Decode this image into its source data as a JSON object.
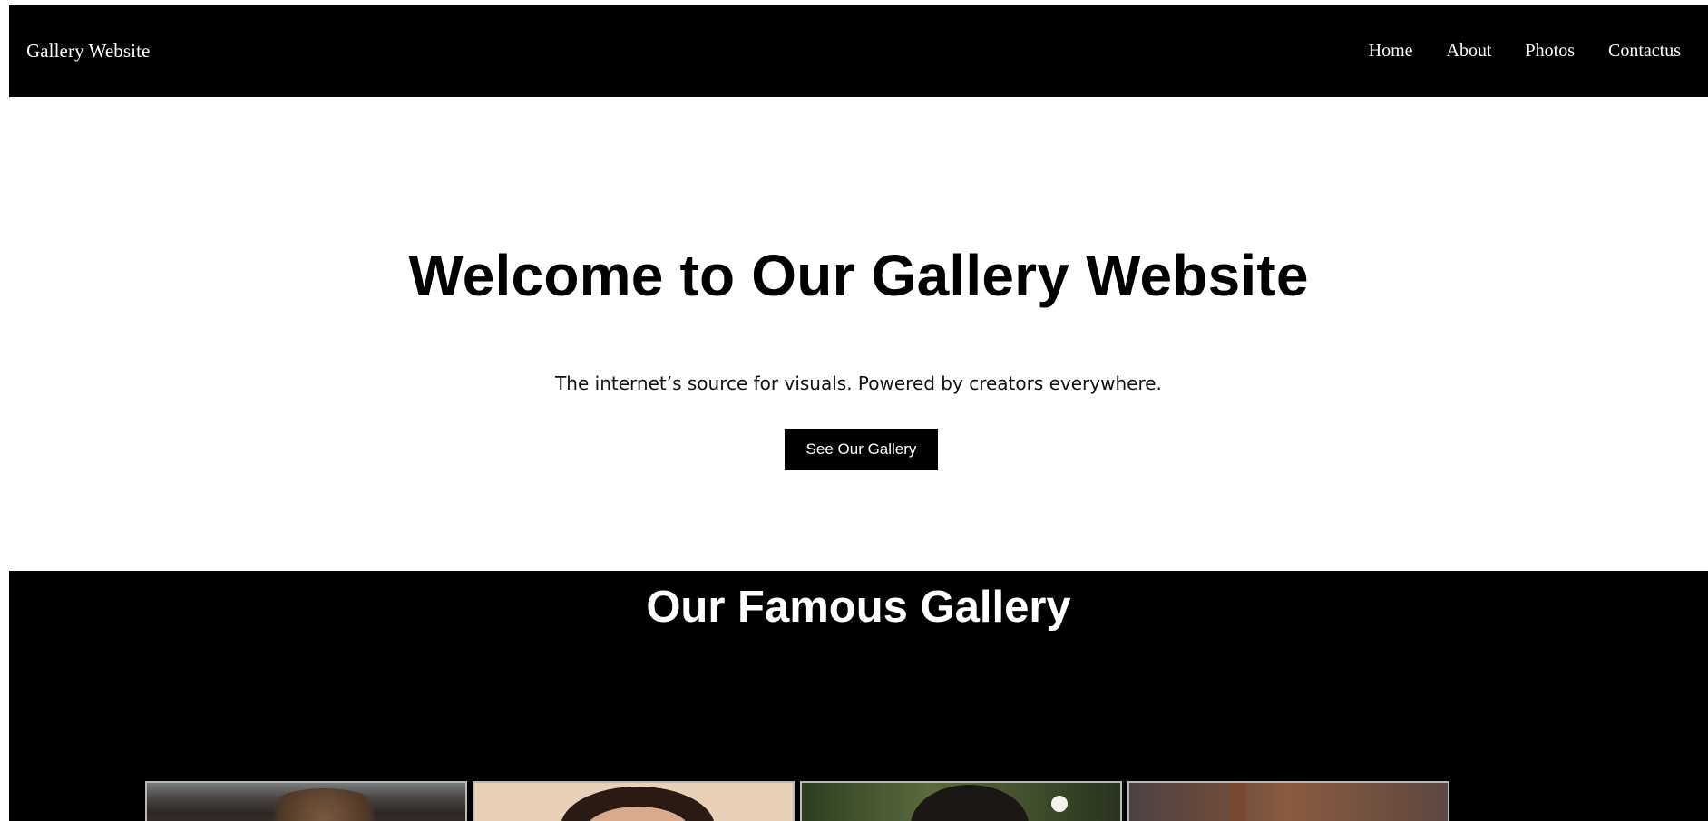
{
  "nav": {
    "brand": "Gallery Website",
    "links": [
      "Home",
      "About",
      "Photos",
      "Contactus"
    ]
  },
  "hero": {
    "title": "Welcome to Our Gallery Website",
    "subtitle": "The internet’s source for visuals. Powered by creators everywhere.",
    "button_label": "See Our Gallery"
  },
  "gallery": {
    "title": "Our Famous Gallery",
    "photos": [
      {
        "icon": "photo-image"
      },
      {
        "icon": "photo-image"
      },
      {
        "icon": "photo-image"
      },
      {
        "icon": "photo-image"
      }
    ]
  },
  "colors": {
    "nav_background": "#000000",
    "gallery_background": "#000000",
    "button_background": "#000000",
    "page_background": "#ffffff"
  }
}
